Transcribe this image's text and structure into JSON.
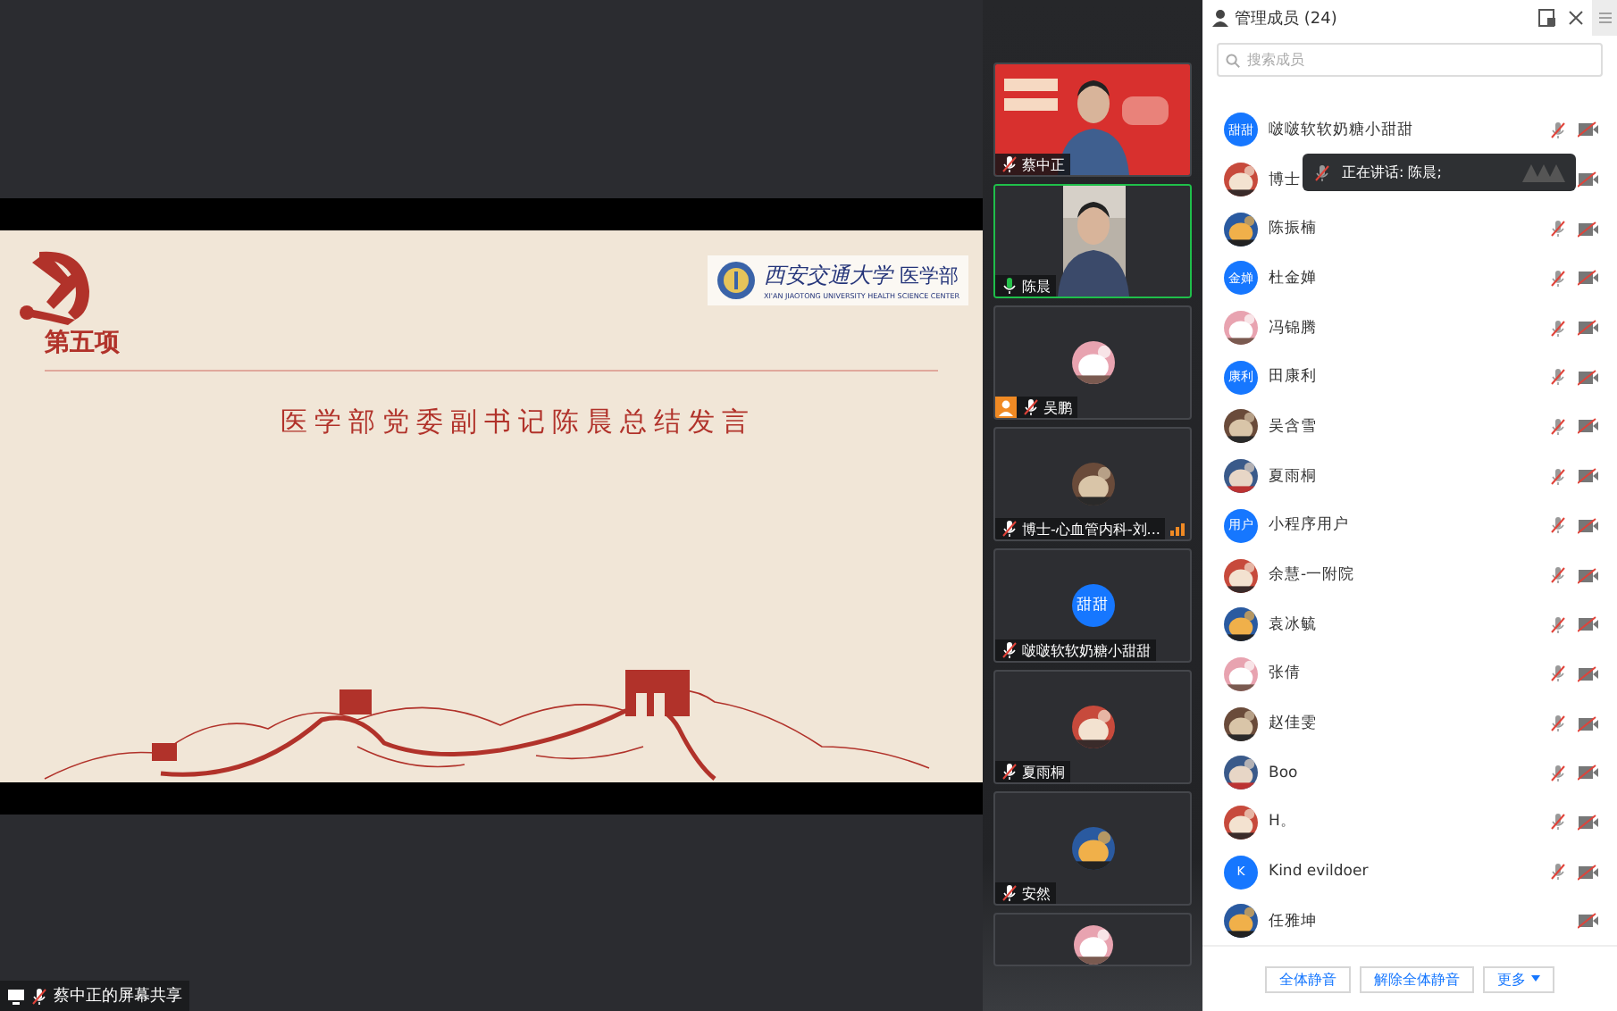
{
  "share_label": "蔡中正的屏幕共享",
  "slide": {
    "section": "第五项",
    "title": "医学部党委副书记陈晨总结发言",
    "logo_cn": "西安交通大学",
    "logo_dept": "医学部",
    "logo_en": "XI'AN JIAOTONG UNIVERSITY HEALTH SCIENCE CENTER"
  },
  "video_tiles": [
    {
      "kind": "video",
      "name": "蔡中正",
      "speaking": false,
      "host": false,
      "signal": false
    },
    {
      "kind": "video",
      "name": "陈晨",
      "speaking": true,
      "host": false,
      "signal": false
    },
    {
      "kind": "picture",
      "name": "吴鹏",
      "speaking": false,
      "host": true,
      "signal": false
    },
    {
      "kind": "picture",
      "name": "博士-心血管内科-刘...",
      "speaking": false,
      "host": false,
      "signal": true
    },
    {
      "kind": "text",
      "avatar_text": "甜甜",
      "name": "啵啵软软奶糖小甜甜",
      "speaking": false,
      "host": false,
      "signal": false
    },
    {
      "kind": "picture",
      "name": "夏雨桐",
      "speaking": false,
      "host": false,
      "signal": false
    },
    {
      "kind": "picture",
      "name": "安然",
      "speaking": false,
      "host": false,
      "signal": false
    },
    {
      "kind": "cut"
    }
  ],
  "panel": {
    "title": "管理成员 (24)",
    "search_placeholder": "搜索成员",
    "members": [
      {
        "kind": "text",
        "avatar_text": "甜甜",
        "name": "啵啵软软奶糖小甜甜",
        "mic_muted": true
      },
      {
        "kind": "picture",
        "name": "博士"
      },
      {
        "kind": "picture",
        "name": "陈振楠",
        "mic_muted": true
      },
      {
        "kind": "text",
        "avatar_text": "金婵",
        "name": "杜金婵",
        "mic_muted": true
      },
      {
        "kind": "picture",
        "name": "冯锦腾",
        "mic_muted": true
      },
      {
        "kind": "text",
        "avatar_text": "康利",
        "name": "田康利",
        "mic_muted": true
      },
      {
        "kind": "picture",
        "name": "吴含雪",
        "mic_muted": true
      },
      {
        "kind": "picture",
        "name": "夏雨桐",
        "mic_muted": true
      },
      {
        "kind": "text",
        "avatar_text": "用户",
        "name": "小程序用户",
        "mic_muted": true
      },
      {
        "kind": "picture",
        "name": "余慧-一附院",
        "mic_muted": true
      },
      {
        "kind": "picture",
        "name": "袁冰毓",
        "mic_muted": true
      },
      {
        "kind": "picture",
        "name": "张倩",
        "mic_muted": true
      },
      {
        "kind": "picture",
        "name": "赵佳雯",
        "mic_muted": true
      },
      {
        "kind": "picture",
        "name": "Boo",
        "mic_muted": true
      },
      {
        "kind": "picture",
        "name": "H。",
        "mic_muted": true
      },
      {
        "kind": "text",
        "avatar_text": "K",
        "name": "Kind evildoer",
        "mic_muted": true
      },
      {
        "kind": "picture",
        "name": "任雅坤",
        "mic_muted": false
      }
    ],
    "tooltip": "正在讲话: 陈晨;",
    "buttons": [
      "全体静音",
      "解除全体静音",
      "更多"
    ]
  }
}
